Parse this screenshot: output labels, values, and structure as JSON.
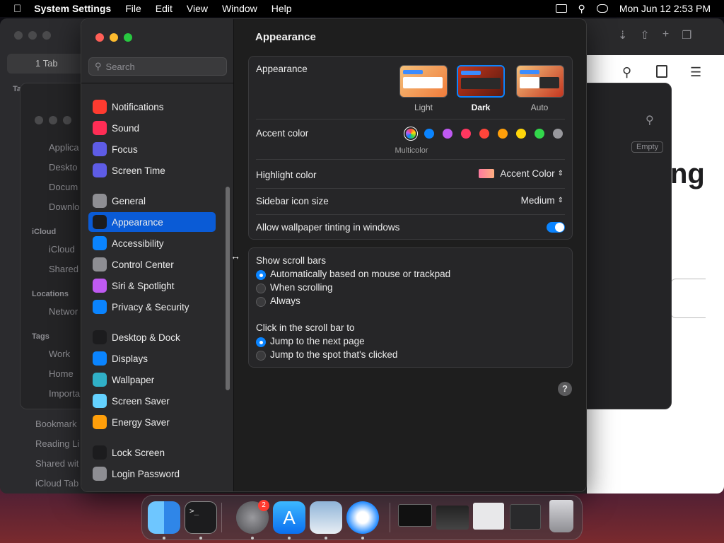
{
  "menubar": {
    "app_name": "System Settings",
    "menus": [
      "File",
      "Edit",
      "View",
      "Window",
      "Help"
    ],
    "datetime": "Mon Jun 12  2:53 PM"
  },
  "safari": {
    "tab_label": "1 Tab",
    "tab_groups_label": "Tab Groups",
    "sidebar_items": [
      "Applica",
      "Deskto",
      "Docum",
      "Downlo"
    ],
    "icloud_label": "iCloud",
    "icloud_items": [
      "iCloud",
      "Shared"
    ],
    "locations_label": "Locations",
    "locations_items": [
      "Networ"
    ],
    "tags_label": "Tags",
    "tags_items": [
      "Work",
      "Home",
      "Importa"
    ],
    "bottom_items": [
      "Bookmark",
      "Reading Li",
      "Shared wit",
      "iCloud Tab"
    ],
    "empty_label": "Empty",
    "big_text": "ng"
  },
  "settings": {
    "search_placeholder": "Search",
    "sidebar": [
      {
        "label": "Notifications",
        "color": "#ff3b30",
        "icon": "bell-icon"
      },
      {
        "label": "Sound",
        "color": "#ff2d55",
        "icon": "speaker-icon"
      },
      {
        "label": "Focus",
        "color": "#5e5ce6",
        "icon": "moon-icon"
      },
      {
        "label": "Screen Time",
        "color": "#5e5ce6",
        "icon": "hourglass-icon"
      },
      {
        "label": "General",
        "color": "#8e8e93",
        "icon": "gear-icon"
      },
      {
        "label": "Appearance",
        "color": "#1c1c1e",
        "icon": "appearance-icon",
        "selected": true
      },
      {
        "label": "Accessibility",
        "color": "#0a84ff",
        "icon": "accessibility-icon"
      },
      {
        "label": "Control Center",
        "color": "#8e8e93",
        "icon": "control-center-icon"
      },
      {
        "label": "Siri & Spotlight",
        "color": "#bf5af2",
        "icon": "siri-icon"
      },
      {
        "label": "Privacy & Security",
        "color": "#0a84ff",
        "icon": "hand-icon"
      },
      {
        "label": "Desktop & Dock",
        "color": "#1c1c1e",
        "icon": "dock-icon"
      },
      {
        "label": "Displays",
        "color": "#0a84ff",
        "icon": "sun-icon"
      },
      {
        "label": "Wallpaper",
        "color": "#30b0c7",
        "icon": "flower-icon"
      },
      {
        "label": "Screen Saver",
        "color": "#64d2ff",
        "icon": "screensaver-icon"
      },
      {
        "label": "Energy Saver",
        "color": "#ff9f0a",
        "icon": "bulb-icon"
      },
      {
        "label": "Lock Screen",
        "color": "#1c1c1e",
        "icon": "lock-icon"
      },
      {
        "label": "Login Password",
        "color": "#8e8e93",
        "icon": "key-icon"
      }
    ],
    "title": "Appearance",
    "appearance_label": "Appearance",
    "appearance_options": [
      "Light",
      "Dark",
      "Auto"
    ],
    "appearance_selected": "Dark",
    "accent_label": "Accent color",
    "accent_colors": [
      "#ff453a",
      "#0a84ff",
      "#bf5af2",
      "#ff375f",
      "#ff453a",
      "#ff9f0a",
      "#ffd60a",
      "#32d74b",
      "#98989d"
    ],
    "accent_selected_label": "Multicolor",
    "highlight_label": "Highlight color",
    "highlight_value": "Accent Color",
    "sidebar_icon_label": "Sidebar icon size",
    "sidebar_icon_value": "Medium",
    "tinting_label": "Allow wallpaper tinting in windows",
    "tinting_on": true,
    "scroll_bars_label": "Show scroll bars",
    "scroll_options": [
      "Automatically based on mouse or trackpad",
      "When scrolling",
      "Always"
    ],
    "click_label": "Click in the scroll bar to",
    "click_options": [
      "Jump to the next page",
      "Jump to the spot that's clicked"
    ],
    "help_label": "?"
  },
  "dock": {
    "badge_count": "2"
  }
}
